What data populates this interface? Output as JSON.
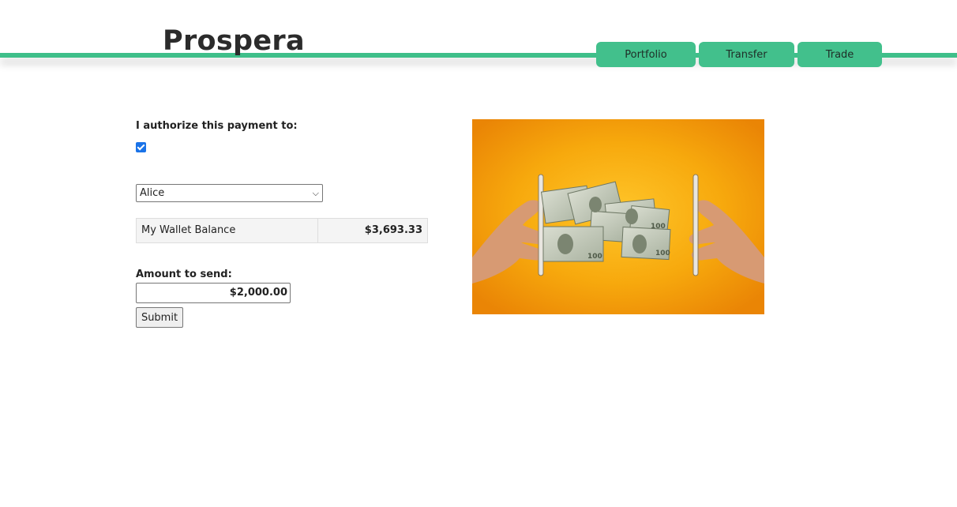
{
  "header": {
    "brand": "Prospera",
    "nav": {
      "portfolio": "Portfolio",
      "transfer": "Transfer",
      "trade": "Trade"
    }
  },
  "form": {
    "authorize_label": "I authorize this payment to:",
    "authorize_checked": true,
    "recipient_selected": "Alice",
    "wallet_label": "My Wallet Balance",
    "wallet_balance": "$3,693.33",
    "amount_label": "Amount to send:",
    "amount_value": "$2,000.00",
    "submit_label": "Submit"
  },
  "colors": {
    "accent": "#42c08c",
    "hero_background": "#f5a70a"
  },
  "icons": {
    "select_chevron": "chevron-down-icon",
    "hero_image": "money-transfer-between-phones"
  }
}
